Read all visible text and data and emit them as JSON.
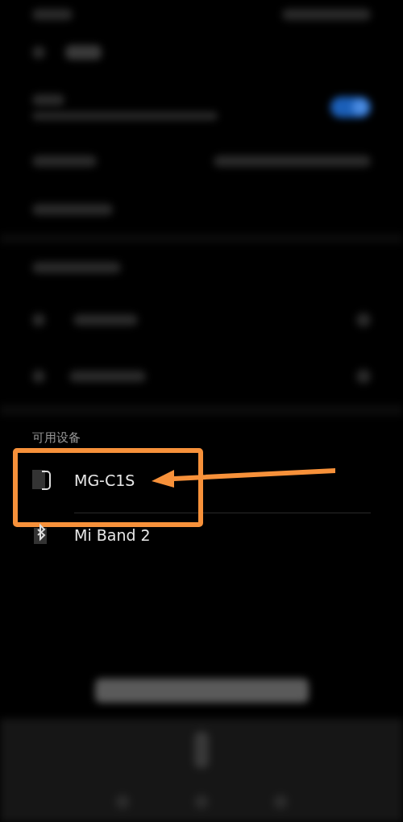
{
  "available_section": {
    "title": "可用设备",
    "devices": [
      {
        "name": "MG-C1S",
        "kind": "phone",
        "highlighted": true
      },
      {
        "name": "Mi Band 2",
        "kind": "bluetooth",
        "highlighted": false
      }
    ]
  }
}
